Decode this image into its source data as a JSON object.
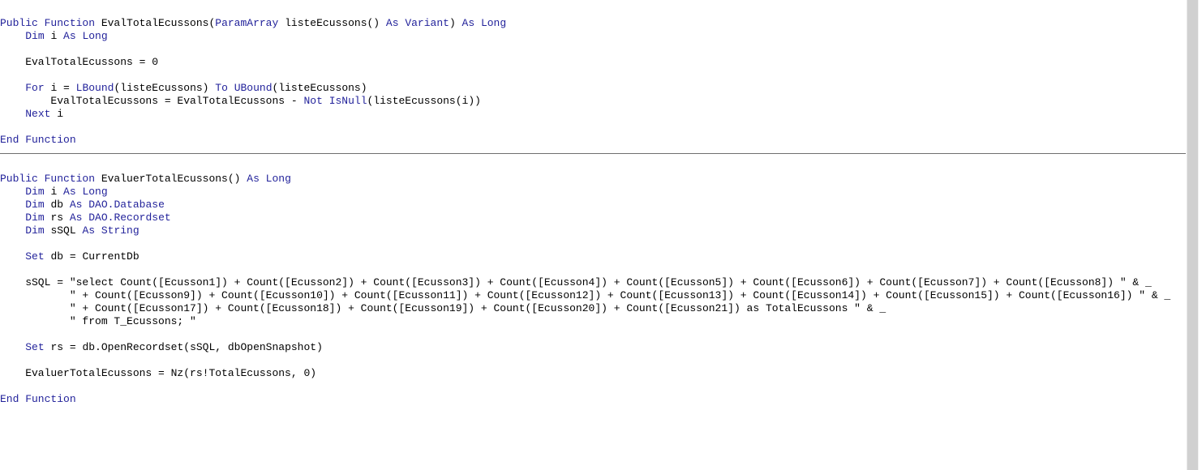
{
  "window": {
    "title": "VBA Code Module",
    "background_color": "#ffffff",
    "keyword_color": "#23239b",
    "text_color": "#000000",
    "scrollbar_color": "#d0d0d0",
    "separator_color": "#6f6f6f"
  },
  "code": {
    "procedure_1": [
      [
        {
          "s": "Public Function ",
          "c": "k"
        },
        {
          "s": "EvalTotalEcussons(",
          "c": "t"
        },
        {
          "s": "ParamArray ",
          "c": "k"
        },
        {
          "s": "listeEcussons() ",
          "c": "t"
        },
        {
          "s": "As Variant",
          "c": "k"
        },
        {
          "s": ") ",
          "c": "t"
        },
        {
          "s": "As Long",
          "c": "k"
        }
      ],
      [
        {
          "s": "    ",
          "c": "t"
        },
        {
          "s": "Dim ",
          "c": "k"
        },
        {
          "s": "i ",
          "c": "t"
        },
        {
          "s": "As Long",
          "c": "k"
        }
      ],
      [
        {
          "s": "",
          "c": "t"
        }
      ],
      [
        {
          "s": "    EvalTotalEcussons = 0",
          "c": "t"
        }
      ],
      [
        {
          "s": "",
          "c": "t"
        }
      ],
      [
        {
          "s": "    ",
          "c": "t"
        },
        {
          "s": "For ",
          "c": "k"
        },
        {
          "s": "i = ",
          "c": "t"
        },
        {
          "s": "LBound",
          "c": "k"
        },
        {
          "s": "(listeEcussons) ",
          "c": "t"
        },
        {
          "s": "To ",
          "c": "k"
        },
        {
          "s": "UBound",
          "c": "k"
        },
        {
          "s": "(listeEcussons)",
          "c": "t"
        }
      ],
      [
        {
          "s": "        EvalTotalEcussons = EvalTotalEcussons - ",
          "c": "t"
        },
        {
          "s": "Not ",
          "c": "k"
        },
        {
          "s": "IsNull",
          "c": "k"
        },
        {
          "s": "(listeEcussons(i))",
          "c": "t"
        }
      ],
      [
        {
          "s": "    ",
          "c": "t"
        },
        {
          "s": "Next ",
          "c": "k"
        },
        {
          "s": "i",
          "c": "t"
        }
      ],
      [
        {
          "s": "",
          "c": "t"
        }
      ],
      [
        {
          "s": "End Function",
          "c": "k"
        }
      ]
    ],
    "separator": true,
    "procedure_2": [
      [
        {
          "s": "",
          "c": "t"
        }
      ],
      [
        {
          "s": "Public Function ",
          "c": "k"
        },
        {
          "s": "EvaluerTotalEcussons() ",
          "c": "t"
        },
        {
          "s": "As Long",
          "c": "k"
        }
      ],
      [
        {
          "s": "    ",
          "c": "t"
        },
        {
          "s": "Dim ",
          "c": "k"
        },
        {
          "s": "i ",
          "c": "t"
        },
        {
          "s": "As Long",
          "c": "k"
        }
      ],
      [
        {
          "s": "    ",
          "c": "t"
        },
        {
          "s": "Dim ",
          "c": "k"
        },
        {
          "s": "db ",
          "c": "t"
        },
        {
          "s": "As ",
          "c": "k"
        },
        {
          "s": "DAO.Database",
          "c": "k"
        }
      ],
      [
        {
          "s": "    ",
          "c": "t"
        },
        {
          "s": "Dim ",
          "c": "k"
        },
        {
          "s": "rs ",
          "c": "t"
        },
        {
          "s": "As ",
          "c": "k"
        },
        {
          "s": "DAO.Recordset",
          "c": "k"
        }
      ],
      [
        {
          "s": "    ",
          "c": "t"
        },
        {
          "s": "Dim ",
          "c": "k"
        },
        {
          "s": "sSQL ",
          "c": "t"
        },
        {
          "s": "As String",
          "c": "k"
        }
      ],
      [
        {
          "s": "",
          "c": "t"
        }
      ],
      [
        {
          "s": "    ",
          "c": "t"
        },
        {
          "s": "Set ",
          "c": "k"
        },
        {
          "s": "db = CurrentDb",
          "c": "t"
        }
      ],
      [
        {
          "s": "",
          "c": "t"
        }
      ],
      [
        {
          "s": "    sSQL = \"select Count([Ecusson1]) + Count([Ecusson2]) + Count([Ecusson3]) + Count([Ecusson4]) + Count([Ecusson5]) + Count([Ecusson6]) + Count([Ecusson7]) + Count([Ecusson8]) \" & _",
          "c": "t"
        }
      ],
      [
        {
          "s": "           \" + Count([Ecusson9]) + Count([Ecusson10]) + Count([Ecusson11]) + Count([Ecusson12]) + Count([Ecusson13]) + Count([Ecusson14]) + Count([Ecusson15]) + Count([Ecusson16]) \" & _",
          "c": "t"
        }
      ],
      [
        {
          "s": "           \" + Count([Ecusson17]) + Count([Ecusson18]) + Count([Ecusson19]) + Count([Ecusson20]) + Count([Ecusson21]) as TotalEcussons \" & _",
          "c": "t"
        }
      ],
      [
        {
          "s": "           \" from T_Ecussons; \"",
          "c": "t"
        }
      ],
      [
        {
          "s": "",
          "c": "t"
        }
      ],
      [
        {
          "s": "    ",
          "c": "t"
        },
        {
          "s": "Set ",
          "c": "k"
        },
        {
          "s": "rs = db.OpenRecordset(sSQL, dbOpenSnapshot)",
          "c": "t"
        }
      ],
      [
        {
          "s": "",
          "c": "t"
        }
      ],
      [
        {
          "s": "    EvaluerTotalEcussons = Nz(rs!TotalEcussons, 0)",
          "c": "t"
        }
      ],
      [
        {
          "s": "",
          "c": "t"
        }
      ],
      [
        {
          "s": "End Function",
          "c": "k"
        }
      ]
    ]
  },
  "scrollbar": {
    "orientation": "vertical",
    "position": "right"
  }
}
